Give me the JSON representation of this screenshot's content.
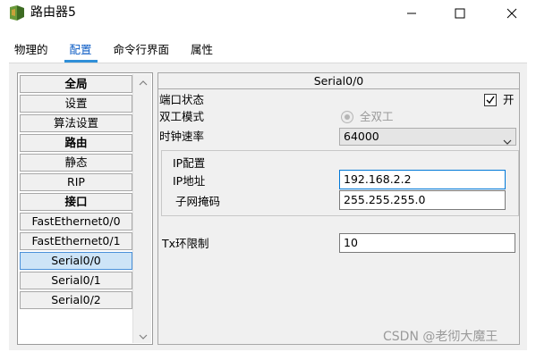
{
  "window": {
    "title": "路由器5",
    "icon": "router-icon",
    "controls": [
      "minimize-icon",
      "maximize-icon",
      "close-icon"
    ]
  },
  "tabs": [
    {
      "label": "物理的",
      "active": false
    },
    {
      "label": "配置",
      "active": true
    },
    {
      "label": "命令行界面",
      "active": false
    },
    {
      "label": "属性",
      "active": false
    }
  ],
  "nav": {
    "items": [
      {
        "label": "全局",
        "type": "header"
      },
      {
        "label": "设置",
        "type": "item"
      },
      {
        "label": "算法设置",
        "type": "item"
      },
      {
        "label": "路由",
        "type": "header"
      },
      {
        "label": "静态",
        "type": "item"
      },
      {
        "label": "RIP",
        "type": "item"
      },
      {
        "label": "接口",
        "type": "header"
      },
      {
        "label": "FastEthernet0/0",
        "type": "item"
      },
      {
        "label": "FastEthernet0/1",
        "type": "item"
      },
      {
        "label": "Serial0/0",
        "type": "item",
        "selected": true
      },
      {
        "label": "Serial0/1",
        "type": "item"
      },
      {
        "label": "Serial0/2",
        "type": "item"
      }
    ]
  },
  "config": {
    "header": "Serial0/0",
    "port_status_label": "端口状态",
    "port_status_checked": true,
    "port_status_on_label": "开",
    "duplex_label": "双工模式",
    "duplex_option": "全双工",
    "clock_rate_label": "时钟速率",
    "clock_rate_value": "64000",
    "ip_group_label": "IP配置",
    "ip_address_label": "IP地址",
    "ip_address_value": "192.168.2.2",
    "subnet_mask_label": "子网掩码",
    "subnet_mask_value": "255.255.255.0",
    "tx_ring_label": "Tx环限制",
    "tx_ring_value": "10"
  },
  "watermark": "CSDN @老彻大魔王",
  "colors": {
    "accent": "#0a5bc4",
    "tab_underline": "#2f8fd8",
    "selected_bg": "#cde4f7",
    "focus_border": "#0078d7"
  }
}
